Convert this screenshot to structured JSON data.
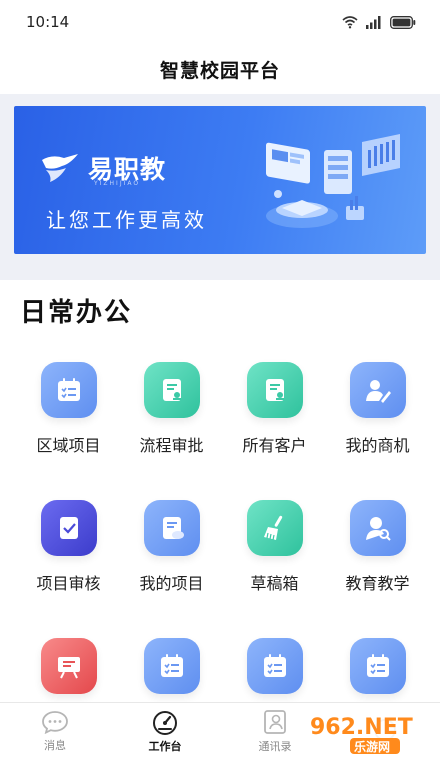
{
  "status_bar": {
    "time": "10:14",
    "icons": [
      "wifi-icon",
      "signal-icon",
      "battery-icon"
    ]
  },
  "header": {
    "title": "智慧校园平台"
  },
  "banner": {
    "brand": "易职教",
    "brand_sub": "YIZHIJIAO",
    "slogan": "让您工作更高效"
  },
  "section": {
    "title": "日常办公"
  },
  "grid": {
    "items": [
      {
        "label": "区域项目",
        "icon": "calendar-list-icon",
        "color": "#6f9cf3"
      },
      {
        "label": "流程审批",
        "icon": "document-stamp-icon",
        "color": "#47d2b0"
      },
      {
        "label": "所有客户",
        "icon": "document-stamp-icon",
        "color": "#47d2b0"
      },
      {
        "label": "我的商机",
        "icon": "user-edit-icon",
        "color": "#6f9cf3"
      },
      {
        "label": "项目审核",
        "icon": "review-check-icon",
        "color": "#5252de"
      },
      {
        "label": "我的项目",
        "icon": "document-cloud-icon",
        "color": "#6f9cf3"
      },
      {
        "label": "草稿箱",
        "icon": "broom-icon",
        "color": "#47d2b0"
      },
      {
        "label": "教育教学",
        "icon": "teacher-search-icon",
        "color": "#6f9cf3"
      },
      {
        "label": "",
        "icon": "presentation-board-icon",
        "color": "#ee5f63"
      },
      {
        "label": "",
        "icon": "calendar-list-icon",
        "color": "#6f9cf3"
      },
      {
        "label": "",
        "icon": "calendar-list-icon",
        "color": "#6f9cf3"
      },
      {
        "label": "",
        "icon": "calendar-list-icon",
        "color": "#6f9cf3"
      }
    ]
  },
  "tabbar": {
    "tabs": [
      {
        "label": "消息",
        "icon": "chat-bubble-icon",
        "active": false
      },
      {
        "label": "工作台",
        "icon": "dashboard-gauge-icon",
        "active": true
      },
      {
        "label": "通讯录",
        "icon": "contacts-icon",
        "active": false
      },
      {
        "label": "",
        "icon": "more-icon",
        "active": false
      }
    ]
  },
  "watermark": {
    "text": "962.NET",
    "sub": "乐游网"
  }
}
